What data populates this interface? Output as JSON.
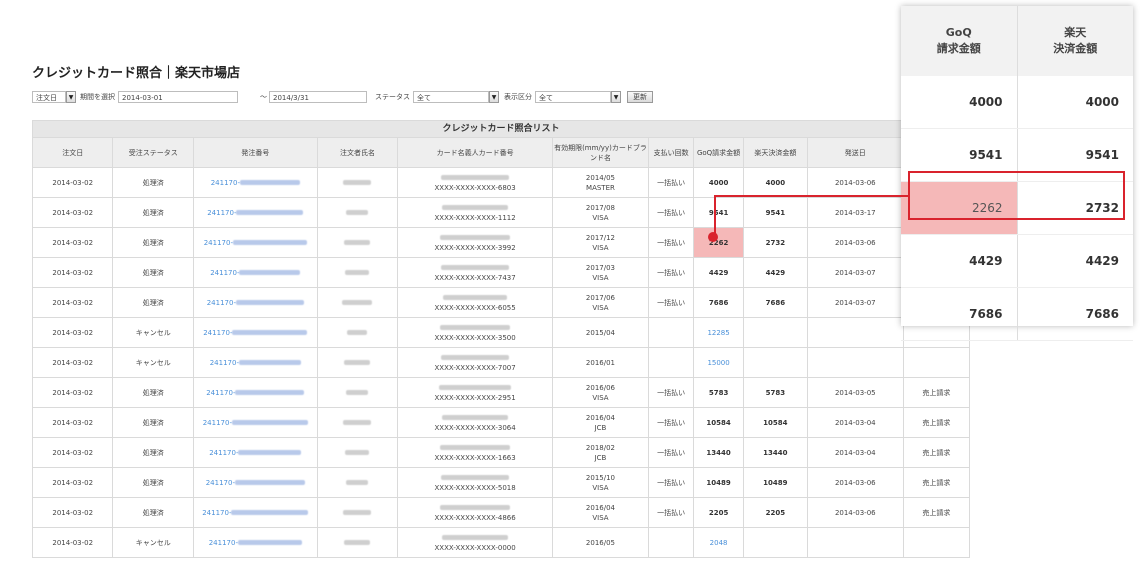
{
  "page": {
    "title": "クレジットカード照合｜楽天市場店"
  },
  "filters": {
    "date_type": "注文日",
    "period_label": "期間を選択",
    "date_from": "2014-03-01",
    "tilde": "～",
    "date_to": "2014/3/31",
    "status_label": "ステータス",
    "status_value": "全て",
    "display_label": "表示区分",
    "display_value": "全て",
    "refresh_button": "更新"
  },
  "table": {
    "caption": "クレジットカード照合リスト",
    "headers": [
      "注文日",
      "受注ステータス",
      "発注番号",
      "注文者氏名",
      "カード名義人カード番号",
      "有効期限(mm/yy)カードブランド名",
      "支払い回数",
      "GoQ請求金額",
      "楽天決済金額",
      "発送日",
      ""
    ],
    "order_prefix": "241170-",
    "rows": [
      {
        "date": "2014-03-02",
        "status": "処理済",
        "card": "XXXX-XXXX-XXXX-6803",
        "exp": "2014/05",
        "brand": "MASTER",
        "pay": "一括払い",
        "goq": "4000",
        "rakuten": "4000",
        "ship": "2014-03-06",
        "extra": ""
      },
      {
        "date": "2014-03-02",
        "status": "処理済",
        "card": "XXXX-XXXX-XXXX-1112",
        "exp": "2017/08",
        "brand": "VISA",
        "pay": "一括払い",
        "goq": "9541",
        "rakuten": "9541",
        "ship": "2014-03-17",
        "extra": ""
      },
      {
        "date": "2014-03-02",
        "status": "処理済",
        "card": "XXXX-XXXX-XXXX-3992",
        "exp": "2017/12",
        "brand": "VISA",
        "pay": "一括払い",
        "goq": "2262",
        "rakuten": "2732",
        "ship": "2014-03-06",
        "extra": ""
      },
      {
        "date": "2014-03-02",
        "status": "処理済",
        "card": "XXXX-XXXX-XXXX-7437",
        "exp": "2017/03",
        "brand": "VISA",
        "pay": "一括払い",
        "goq": "4429",
        "rakuten": "4429",
        "ship": "2014-03-07",
        "extra": ""
      },
      {
        "date": "2014-03-02",
        "status": "処理済",
        "card": "XXXX-XXXX-XXXX-6055",
        "exp": "2017/06",
        "brand": "VISA",
        "pay": "一括払い",
        "goq": "7686",
        "rakuten": "7686",
        "ship": "2014-03-07",
        "extra": ""
      },
      {
        "date": "2014-03-02",
        "status": "キャンセル",
        "card": "XXXX-XXXX-XXXX-3500",
        "exp": "2015/04",
        "brand": "",
        "pay": "",
        "goq": "12285",
        "rakuten": "",
        "ship": "",
        "extra": ""
      },
      {
        "date": "2014-03-02",
        "status": "キャンセル",
        "card": "XXXX-XXXX-XXXX-7007",
        "exp": "2016/01",
        "brand": "",
        "pay": "",
        "goq": "15000",
        "rakuten": "",
        "ship": "",
        "extra": ""
      },
      {
        "date": "2014-03-02",
        "status": "処理済",
        "card": "XXXX-XXXX-XXXX-2951",
        "exp": "2016/06",
        "brand": "VISA",
        "pay": "一括払い",
        "goq": "5783",
        "rakuten": "5783",
        "ship": "2014-03-05",
        "extra": "売上請求"
      },
      {
        "date": "2014-03-02",
        "status": "処理済",
        "card": "XXXX-XXXX-XXXX-3064",
        "exp": "2016/04",
        "brand": "JCB",
        "pay": "一括払い",
        "goq": "10584",
        "rakuten": "10584",
        "ship": "2014-03-04",
        "extra": "売上請求"
      },
      {
        "date": "2014-03-02",
        "status": "処理済",
        "card": "XXXX-XXXX-XXXX-1663",
        "exp": "2018/02",
        "brand": "JCB",
        "pay": "一括払い",
        "goq": "13440",
        "rakuten": "13440",
        "ship": "2014-03-04",
        "extra": "売上請求"
      },
      {
        "date": "2014-03-02",
        "status": "処理済",
        "card": "XXXX-XXXX-XXXX-5018",
        "exp": "2015/10",
        "brand": "VISA",
        "pay": "一括払い",
        "goq": "10489",
        "rakuten": "10489",
        "ship": "2014-03-06",
        "extra": "売上請求"
      },
      {
        "date": "2014-03-02",
        "status": "処理済",
        "card": "XXXX-XXXX-XXXX-4866",
        "exp": "2016/04",
        "brand": "VISA",
        "pay": "一括払い",
        "goq": "2205",
        "rakuten": "2205",
        "ship": "2014-03-06",
        "extra": "売上請求"
      },
      {
        "date": "2014-03-02",
        "status": "キャンセル",
        "card": "XXXX-XXXX-XXXX-0000",
        "exp": "2016/05",
        "brand": "",
        "pay": "",
        "goq": "2048",
        "rakuten": "",
        "ship": "",
        "extra": ""
      }
    ]
  },
  "zoom": {
    "header_goq_1": "GoQ",
    "header_goq_2": "請求金額",
    "header_rakuten_1": "楽天",
    "header_rakuten_2": "決済金額",
    "rows": [
      {
        "goq": "4000",
        "rakuten": "4000"
      },
      {
        "goq": "9541",
        "rakuten": "9541"
      },
      {
        "goq": "2262",
        "rakuten": "2732"
      },
      {
        "goq": "4429",
        "rakuten": "4429"
      },
      {
        "goq": "7686",
        "rakuten": "7686"
      }
    ]
  },
  "colors": {
    "highlight": "#f5b8b8",
    "annotation": "#d9232d",
    "link": "#4a90d9"
  }
}
